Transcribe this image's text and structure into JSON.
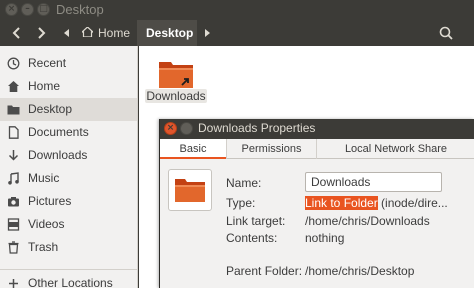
{
  "window": {
    "title": "Desktop"
  },
  "toolbar": {
    "breadcrumbs": [
      {
        "label": "Home",
        "icon": "home-icon"
      },
      {
        "label": "Desktop"
      }
    ]
  },
  "sidebar": {
    "items": [
      {
        "label": "Recent",
        "icon": "clock-icon"
      },
      {
        "label": "Home",
        "icon": "home-icon"
      },
      {
        "label": "Desktop",
        "icon": "folder-icon",
        "active": true
      },
      {
        "label": "Documents",
        "icon": "document-icon"
      },
      {
        "label": "Downloads",
        "icon": "download-icon"
      },
      {
        "label": "Music",
        "icon": "music-icon"
      },
      {
        "label": "Pictures",
        "icon": "camera-icon"
      },
      {
        "label": "Videos",
        "icon": "video-icon"
      },
      {
        "label": "Trash",
        "icon": "trash-icon"
      },
      {
        "label": "Other Locations",
        "icon": "plus-icon"
      }
    ]
  },
  "main": {
    "files": [
      {
        "label": "Downloads",
        "icon": "folder-link-icon"
      }
    ]
  },
  "dialog": {
    "title": "Downloads Properties",
    "tabs": [
      {
        "label": "Basic",
        "active": true
      },
      {
        "label": "Permissions"
      },
      {
        "label": "Local Network Share"
      }
    ],
    "fields": {
      "name_label": "Name:",
      "name_value": "Downloads",
      "type_label": "Type:",
      "type_highlight": "Link to Folder",
      "type_rest": " (inode/dire...",
      "link_target_label": "Link target:",
      "link_target_value": "/home/chris/Downloads",
      "contents_label": "Contents:",
      "contents_value": "nothing",
      "parent_label": "Parent Folder:",
      "parent_value": "/home/chris/Desktop"
    }
  },
  "colors": {
    "accent": "#e95420",
    "titlebar": "#3c3b37",
    "sidebar_bg": "#f2f1f0",
    "folder": "#e2672c"
  }
}
